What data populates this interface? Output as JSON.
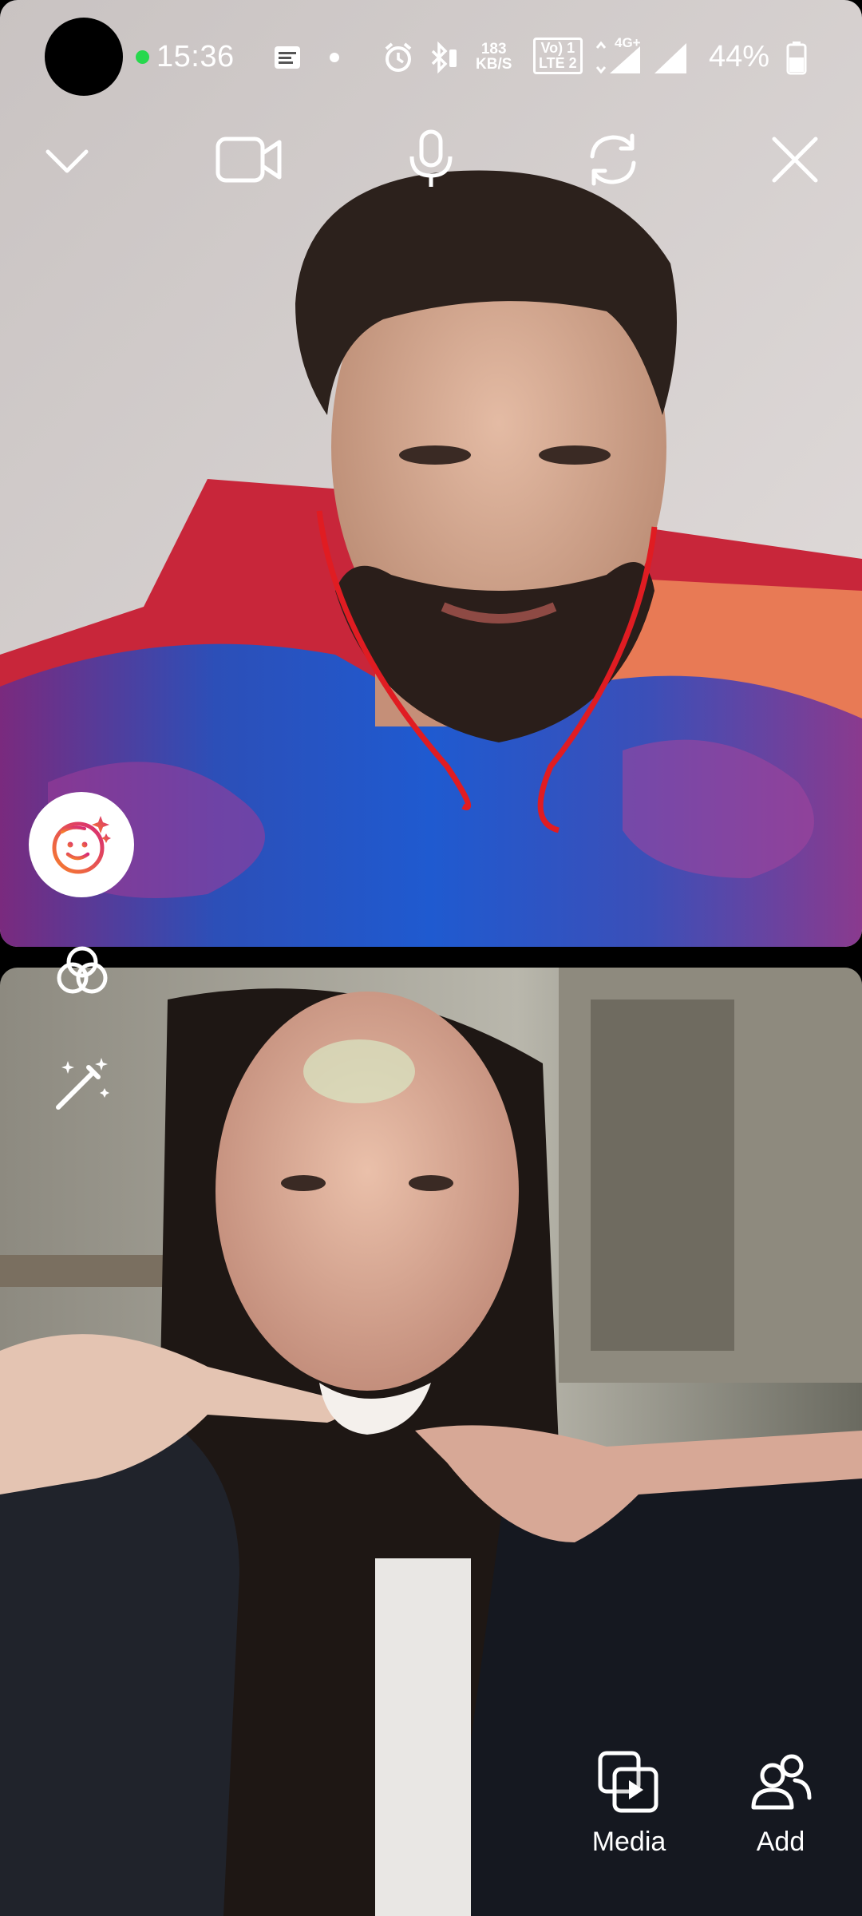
{
  "status_bar": {
    "time": "15:36",
    "net_speed_value": "183",
    "net_speed_unit": "KB/S",
    "volte_line1": "Vo) 1",
    "volte_line2": "LTE 2",
    "network_type": "4G+",
    "battery_percent": "44%",
    "icons": [
      "notification-message-icon",
      "alarm-icon",
      "bluetooth-icon",
      "signal-icon",
      "battery-icon"
    ]
  },
  "call_controls": {
    "icons": [
      "chevron-down-icon",
      "video-camera-icon",
      "microphone-icon",
      "switch-camera-icon",
      "close-icon"
    ]
  },
  "side_tools": {
    "icons": [
      "face-effects-icon",
      "filters-icon",
      "magic-wand-icon"
    ]
  },
  "bottom_actions": {
    "media_label": "Media",
    "add_label": "Add",
    "icons": [
      "media-icon",
      "add-people-icon"
    ]
  },
  "colors": {
    "status_dot": "#27d84d",
    "effects_gradient_start": "#f77f2d",
    "effects_gradient_end": "#d62976"
  }
}
